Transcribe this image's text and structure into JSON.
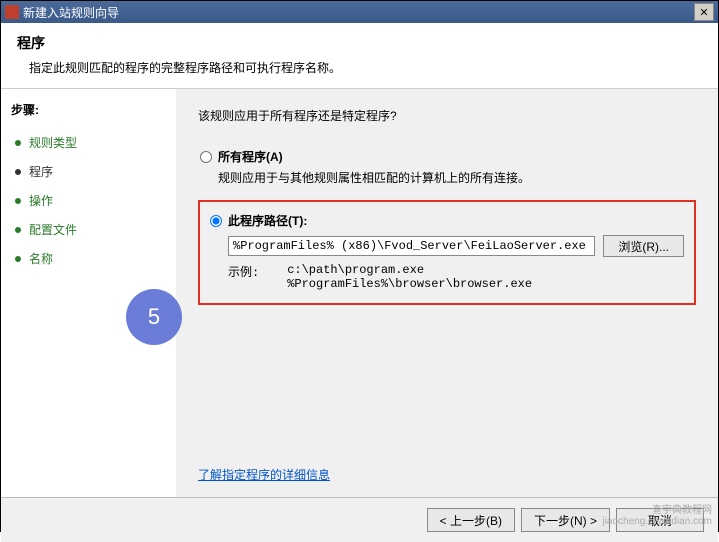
{
  "titlebar": {
    "text": "新建入站规则向导"
  },
  "header": {
    "title": "程序",
    "desc": "指定此规则匹配的程序的完整程序路径和可执行程序名称。"
  },
  "sidebar": {
    "title": "步骤:",
    "items": [
      {
        "label": "规则类型"
      },
      {
        "label": "程序"
      },
      {
        "label": "操作"
      },
      {
        "label": "配置文件"
      },
      {
        "label": "名称"
      }
    ]
  },
  "main": {
    "question": "该规则应用于所有程序还是特定程序?",
    "all_programs": {
      "label": "所有程序(A)",
      "sub": "规则应用于与其他规则属性相匹配的计算机上的所有连接。"
    },
    "this_path": {
      "label": "此程序路径(T):",
      "value": "%ProgramFiles% (x86)\\Fvod_Server\\FeiLaoServer.exe",
      "browse": "浏览(R)...",
      "example_label": "示例:",
      "example_line1": "c:\\path\\program.exe",
      "example_line2": "%ProgramFiles%\\browser\\browser.exe"
    },
    "link": "了解指定程序的详细信息",
    "badge": "5"
  },
  "footer": {
    "back": "< 上一步(B)",
    "next": "下一步(N) >",
    "cancel": "取消"
  },
  "watermark": {
    "line1": "查字典教程网",
    "line2": "jiaocheng.chazidian.com"
  }
}
